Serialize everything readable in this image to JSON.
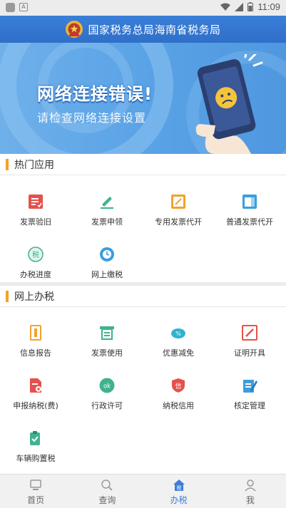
{
  "status_bar": {
    "time": "11:09"
  },
  "header": {
    "title": "国家税务总局海南省税务局"
  },
  "banner": {
    "error_title": "网络连接错误!",
    "error_subtitle": "请检查网络连接设置"
  },
  "hot_apps": {
    "title": "热门应用",
    "items": [
      {
        "label": "发票验旧",
        "icon": "invoice-check-icon"
      },
      {
        "label": "发票申领",
        "icon": "invoice-apply-icon"
      },
      {
        "label": "专用发票代开",
        "icon": "special-invoice-icon"
      },
      {
        "label": "普通发票代开",
        "icon": "general-invoice-icon"
      },
      {
        "label": "办税进度",
        "icon": "tax-progress-icon"
      },
      {
        "label": "网上缴税",
        "icon": "online-payment-icon"
      }
    ]
  },
  "online_tax": {
    "title": "网上办税",
    "items": [
      {
        "label": "信息报告",
        "icon": "info-report-icon"
      },
      {
        "label": "发票使用",
        "icon": "invoice-use-icon"
      },
      {
        "label": "优惠减免",
        "icon": "discount-icon"
      },
      {
        "label": "证明开具",
        "icon": "certificate-icon"
      },
      {
        "label": "申报纳税(费)",
        "icon": "declare-tax-icon"
      },
      {
        "label": "行政许可",
        "icon": "admin-permit-icon"
      },
      {
        "label": "纳税信用",
        "icon": "tax-credit-icon"
      },
      {
        "label": "核定管理",
        "icon": "verify-manage-icon"
      },
      {
        "label": "车辆购置税",
        "icon": "vehicle-tax-icon"
      }
    ]
  },
  "bottom_nav": {
    "items": [
      {
        "label": "首页",
        "icon": "home-icon"
      },
      {
        "label": "查询",
        "icon": "search-icon"
      },
      {
        "label": "办税",
        "icon": "tax-icon",
        "active": true
      },
      {
        "label": "我",
        "icon": "profile-icon"
      }
    ]
  },
  "colors": {
    "header_blue": "#2f6fc8",
    "accent_orange": "#f4a12b",
    "active_nav": "#3d7ed6"
  }
}
